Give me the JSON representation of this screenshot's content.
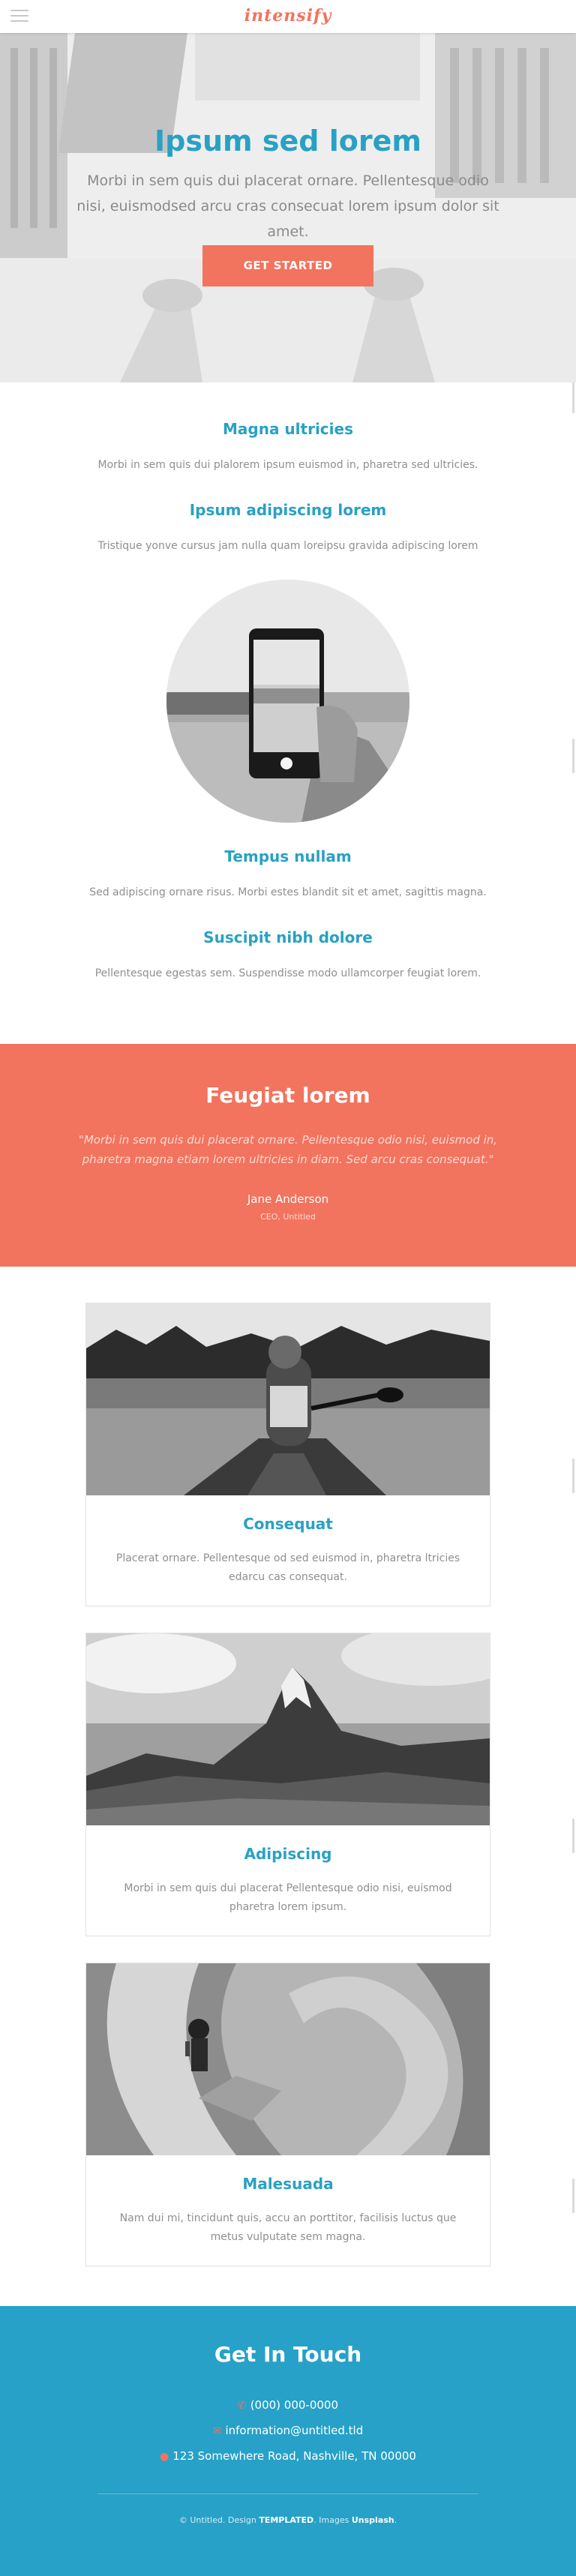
{
  "header": {
    "logo": "intensify",
    "menu_icon": "hamburger-menu-icon"
  },
  "banner": {
    "title": "Ipsum sed lorem",
    "text": "Morbi in sem quis dui placerat ornare. Pellentesque odio nisi, euismodsed arcu cras consecuat lorem ipsum dolor sit amet.",
    "button_label": "GET STARTED"
  },
  "features": [
    {
      "title": "Magna ultricies",
      "text": "Morbi in sem quis dui plalorem ipsum euismod in, pharetra sed ultricies."
    },
    {
      "title": "Ipsum adipiscing lorem",
      "text": "Tristique yonve cursus jam nulla quam loreipsu gravida adipiscing lorem"
    },
    {
      "title": "Tempus nullam",
      "text": "Sed adipiscing ornare risus. Morbi estes blandit sit et amet, sagittis magna."
    },
    {
      "title": "Suscipit nibh dolore",
      "text": "Pellentesque egestas sem. Suspendisse modo ullamcorper feugiat lorem."
    }
  ],
  "testimonial": {
    "title": "Feugiat lorem",
    "quote": "\"Morbi in sem quis dui placerat ornare. Pellentesque odio nisi, euismod in, pharetra magna etiam lorem ultricies in diam. Sed arcu cras consequat.\"",
    "name": "Jane Anderson",
    "role": "CEO, Untitled"
  },
  "cards": [
    {
      "title": "Consequat",
      "text": "Placerat ornare. Pellentesque od sed euismod in, pharetra ltricies edarcu cas consequat."
    },
    {
      "title": "Adipiscing",
      "text": "Morbi in sem quis dui placerat Pellentesque odio nisi, euismod pharetra lorem ipsum."
    },
    {
      "title": "Malesuada",
      "text": "Nam dui mi, tincidunt quis, accu an porttitor, facilisis luctus que metus vulputate sem magna."
    }
  ],
  "footer": {
    "title": "Get In Touch",
    "phone": "(000) 000-0000",
    "email": "information@untitled.tld",
    "address": "123 Somewhere Road, Nashville, TN 00000",
    "copyright_prefix": "© Untitled. Design",
    "design_link": "TEMPLATED",
    "images_prefix": ". Images",
    "images_link": "Unsplash",
    "copyright_suffix": "."
  },
  "colors": {
    "accent": "#f2735e",
    "primary": "#28a1c4",
    "footer_bg": "#27a1c7"
  }
}
